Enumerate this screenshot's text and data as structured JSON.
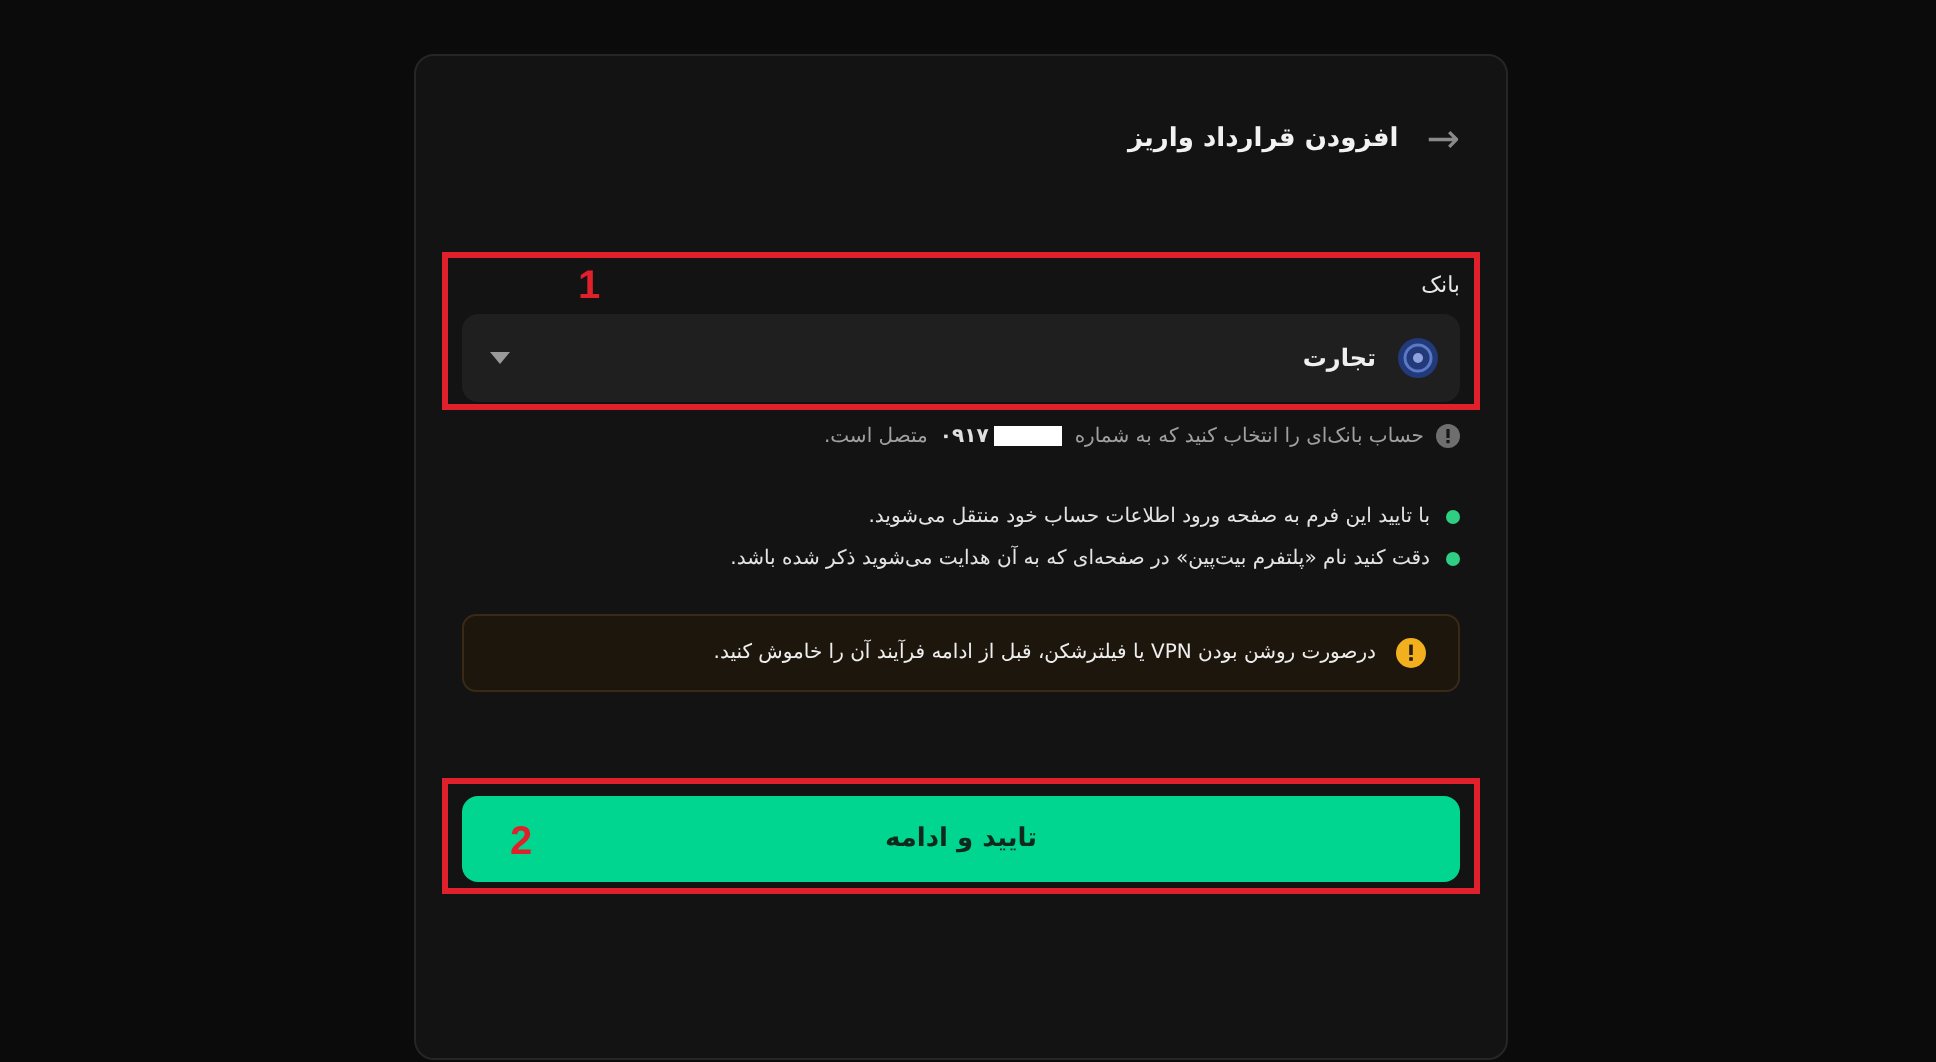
{
  "header": {
    "back_icon": "→",
    "title": "افزودن قرارداد واریز"
  },
  "bank_field": {
    "label": "بانک",
    "value": "تجارت",
    "annotation": "1"
  },
  "hint": {
    "before": "حساب بانک‌ای را انتخاب کنید که به شماره",
    "number": "۰۹۱۷",
    "after": "متصل است."
  },
  "notes": [
    {
      "text": "با تایید این فرم به صفحه ورود اطلاعات حساب خود منتقل می‌شوید."
    },
    {
      "text": "دقت کنید نام «پلتفرم بیت‌پین» در صفحه‌ای که به آن هدایت می‌شوید ذکر شده باشد."
    }
  ],
  "warning": {
    "text": "درصورت روشن بودن VPN یا فیلترشکن، قبل از ادامه فرآیند آن را خاموش کنید."
  },
  "submit": {
    "label": "تایید و ادامه",
    "annotation": "2"
  }
}
